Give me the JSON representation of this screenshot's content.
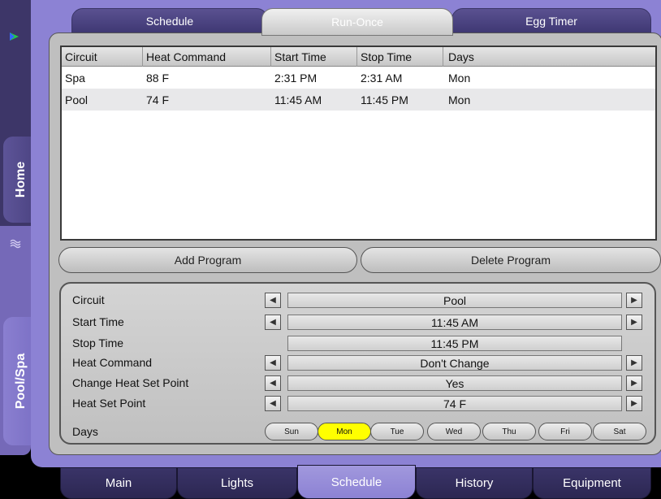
{
  "side_nav": {
    "home_label": "Home",
    "poolspa_label": "Pool/Spa",
    "arrow_icon": "arrow-icon",
    "poolspa_icon": "pool-icon"
  },
  "top_tabs": [
    {
      "label": "Schedule",
      "selected": false
    },
    {
      "label": "Run-Once",
      "selected": true
    },
    {
      "label": "Egg Timer",
      "selected": false
    }
  ],
  "table": {
    "headers": [
      "Circuit",
      "Heat Command",
      "Start Time",
      "Stop Time",
      "Days"
    ],
    "rows": [
      [
        "Spa",
        "88 F",
        "2:31  PM",
        "2:31  AM",
        "Mon"
      ],
      [
        "Pool",
        "74 F",
        "11:45  AM",
        "11:45  PM",
        "Mon"
      ]
    ]
  },
  "buttons": {
    "add_program": "Add Program",
    "delete_program": "Delete Program"
  },
  "settings": {
    "circuit_label": "Circuit",
    "circuit_value": "Pool",
    "start_time_label": "Start Time",
    "start_time_value": "11:45  AM",
    "stop_time_label": "Stop Time",
    "stop_time_value": "11:45  PM",
    "heat_command_label": "Heat Command",
    "heat_command_value": "Don't Change",
    "change_heat_set_point_label": "Change Heat Set Point",
    "change_heat_set_point_value": "Yes",
    "heat_set_point_label": "Heat Set Point",
    "heat_set_point_value": "74 F",
    "days_label": "Days",
    "days": [
      {
        "label": "Sun",
        "selected": false
      },
      {
        "label": "Mon",
        "selected": true
      },
      {
        "label": "Tue",
        "selected": false
      },
      {
        "label": "Wed",
        "selected": false
      },
      {
        "label": "Thu",
        "selected": false
      },
      {
        "label": "Fri",
        "selected": false
      },
      {
        "label": "Sat",
        "selected": false
      }
    ],
    "arrow_left_icon": "◀",
    "arrow_right_icon": "▶"
  },
  "bottom_tabs": [
    {
      "label": "Main",
      "selected": false
    },
    {
      "label": "Lights",
      "selected": false
    },
    {
      "label": "Schedule",
      "selected": true
    },
    {
      "label": "History",
      "selected": false
    },
    {
      "label": "Equipment",
      "selected": false
    }
  ],
  "colors": {
    "frame_purple": "#8c82d4",
    "dark_tab": "#3e3772",
    "selected_day": "#ffff00"
  }
}
